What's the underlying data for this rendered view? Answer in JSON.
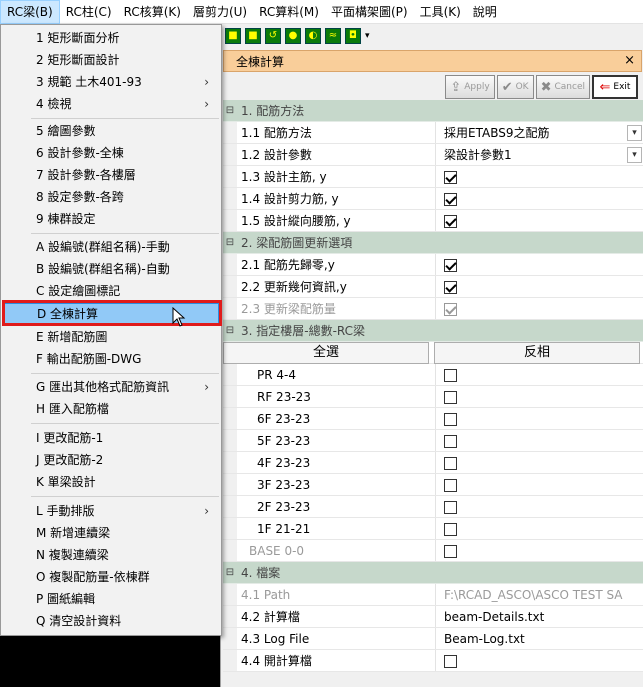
{
  "menubar": [
    "RC梁(B)",
    "RC柱(C)",
    "RC核算(K)",
    "層剪力(U)",
    "RC算料(M)",
    "平面構架圖(P)",
    "工具(K)",
    "說明"
  ],
  "menu": {
    "groups": [
      [
        {
          "label": "1 矩形斷面分析"
        },
        {
          "label": "2 矩形斷面設計"
        },
        {
          "label": "3 規範 土木401-93",
          "submenu": true
        },
        {
          "label": "4 檢視",
          "submenu": true
        }
      ],
      [
        {
          "label": "5 繪圖參數"
        },
        {
          "label": "6 設計參數-全棟"
        },
        {
          "label": "7 設計參數-各樓層"
        },
        {
          "label": "8 設定參數-各跨"
        },
        {
          "label": "9 棟群設定"
        }
      ],
      [
        {
          "label": "A 設編號(群組名稱)-手動"
        },
        {
          "label": "B 設編號(群組名稱)-自動"
        },
        {
          "label": "C 設定繪圖標記"
        },
        {
          "label": "D 全棟計算",
          "highlighted": true
        },
        {
          "label": "E 新增配筋圖"
        },
        {
          "label": "F 輸出配筋圖-DWG"
        }
      ],
      [
        {
          "label": "G 匯出其他格式配筋資訊",
          "submenu": true
        },
        {
          "label": "H 匯入配筋檔"
        }
      ],
      [
        {
          "label": "I 更改配筋-1"
        },
        {
          "label": "J 更改配筋-2"
        },
        {
          "label": "K 單梁設計"
        }
      ],
      [
        {
          "label": "L 手動排版",
          "submenu": true
        },
        {
          "label": "M 新增連續梁"
        },
        {
          "label": "N 複製連續梁"
        },
        {
          "label": "O 複製配筋量-依棟群"
        },
        {
          "label": "P 圖紙編輯"
        },
        {
          "label": "Q 清空設計資料"
        }
      ]
    ]
  },
  "panel": {
    "title": "全棟計算",
    "close": "×",
    "buttons": {
      "apply": "Apply",
      "ok": "OK",
      "cancel": "Cancel",
      "exit": "Exit"
    },
    "sections": {
      "s1": "1. 配筋方法",
      "s2": "2. 梁配筋圖更新選項",
      "s3": "3. 指定樓層-總數-RC梁",
      "s4": "4. 檔案"
    },
    "rows": {
      "r11": {
        "label": "1.1 配筋方法",
        "value": "採用ETABS9之配筋"
      },
      "r12": {
        "label": "1.2 設計參數",
        "value": "梁設計參數1"
      },
      "r13": {
        "label": "1.3 設計主筋, y",
        "checked": true
      },
      "r14": {
        "label": "1.4 設計剪力筋, y",
        "checked": true
      },
      "r15": {
        "label": "1.5 設計縱向腰筋, y",
        "checked": true
      },
      "r21": {
        "label": "2.1 配筋先歸零,y",
        "checked": true
      },
      "r22": {
        "label": "2.2 更新幾何資訊,y",
        "checked": true
      },
      "r23": {
        "label": "2.3 更新梁配筋量",
        "checked": true,
        "disabled": true
      },
      "r41": {
        "label": "4.1 Path",
        "value": "F:\\RCAD_ASCO\\ASCO TEST SA"
      },
      "r42": {
        "label": "4.2 計算檔",
        "value": "beam-Details.txt"
      },
      "r43": {
        "label": "4.3 Log File",
        "value": "Beam-Log.txt"
      },
      "r44": {
        "label": "4.4 開計算檔",
        "checked": false
      }
    },
    "select_all": "全選",
    "invert": "反相",
    "floors": [
      "PR 4-4",
      "RF 23-23",
      "6F 23-23",
      "5F 23-23",
      "4F 23-23",
      "3F 23-23",
      "2F 23-23",
      "1F 21-21",
      "BASE 0-0"
    ]
  }
}
